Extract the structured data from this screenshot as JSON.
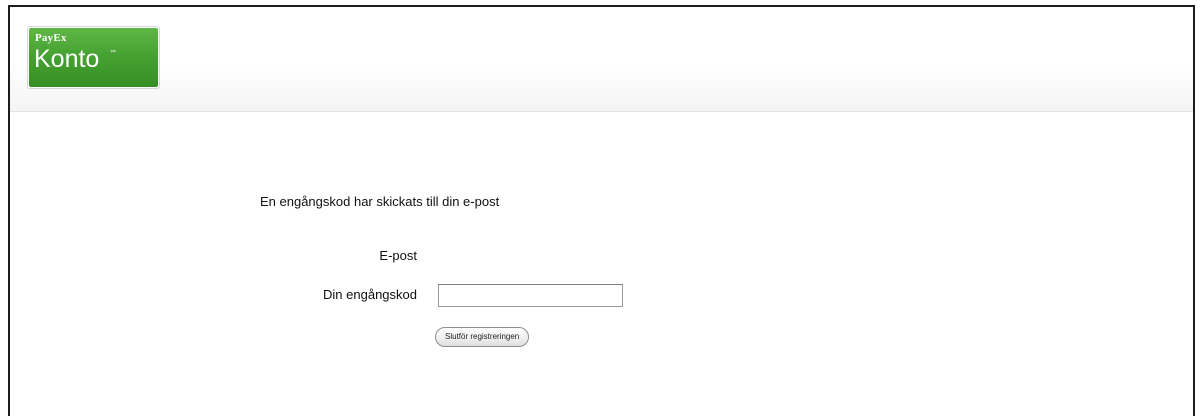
{
  "header": {
    "logo": {
      "brand": "PayEx",
      "name": "Konto",
      "trademark": "™",
      "color": "#46a232"
    }
  },
  "form": {
    "message": "En engångskod har skickats till din e-post",
    "email_label": "E-post",
    "email_value": "",
    "code_label": "Din engångskod",
    "code_value": "",
    "submit_label": "Slutför registreringen"
  }
}
